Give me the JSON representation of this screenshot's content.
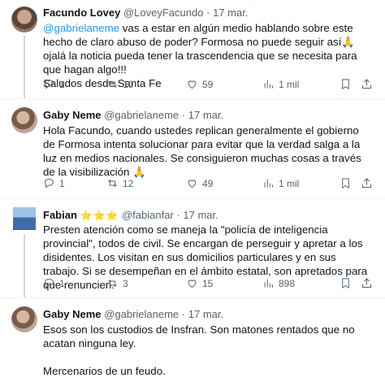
{
  "tweets": [
    {
      "name": "Facundo Lovey",
      "handle": "@LoveyFacundo",
      "dot": "·",
      "date": "17 mar.",
      "mention": "@gabrielaneme",
      "text_after_mention": " vas a estar en algún medio hablando sobre este hecho de claro abuso de poder? Formosa no puede seguir así🙏 ojalá la noticia pueda tener la trascendencia que se necesita para que hagan algo!!!",
      "text_line2": "Saludos desde Santa Fe",
      "replies": "1",
      "retweets": "10",
      "likes": "59",
      "views": "1 mil"
    },
    {
      "name": "Gaby Neme",
      "handle": "@gabrielaneme",
      "dot": "·",
      "date": "17 mar.",
      "text": "Hola Facundo, cuando ustedes replican generalmente el gobierno de Formosa intenta solucionar para evitar que la verdad salga a la luz en medios nacionales. Se consiguieron muchas cosas a través de la visibilización 🙏",
      "replies": "1",
      "retweets": "12",
      "likes": "49",
      "views": "1 mil"
    },
    {
      "name": "Fabian",
      "stars": "⭐⭐⭐",
      "handle": "@fabianfar",
      "dot": "·",
      "date": "17 mar.",
      "text": "Presten atención como se maneja la \"policía de inteligencia provincial\", todos de civil. Se encargan de perseguir y apretar a los disidentes. Los visitan en sus domicilios particulares y en sus trabajo. Si se desempeñan en el ámbito estatal, son apretados para que renuncien.",
      "replies": "1",
      "retweets": "3",
      "likes": "15",
      "views": "898"
    },
    {
      "name": "Gaby Neme",
      "handle": "@gabrielaneme",
      "dot": "·",
      "date": "17 mar.",
      "text_line1": "Esos son los custodios de Insfran. Son matones rentados que no acatan ninguna ley.",
      "text_line2": "Mercenarios de un feudo."
    }
  ]
}
